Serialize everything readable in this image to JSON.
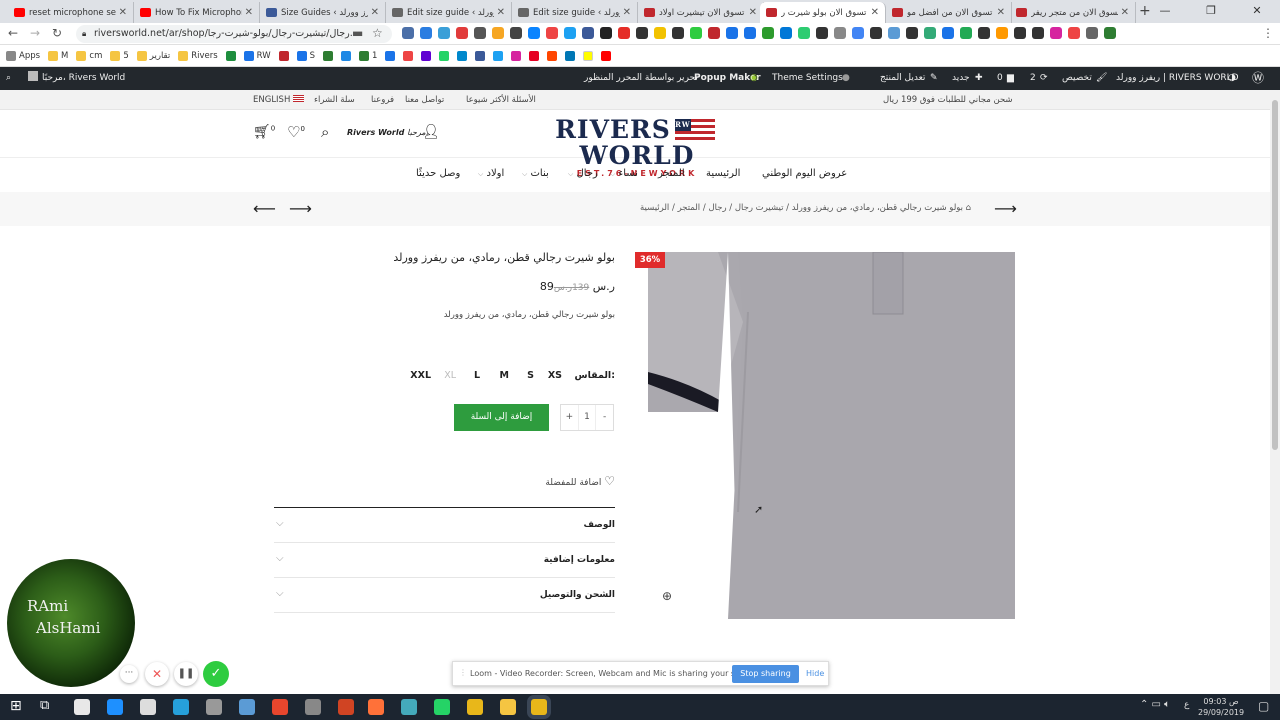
{
  "browser": {
    "tabs": [
      {
        "title": "reset microphone setting",
        "color": "#ff0000"
      },
      {
        "title": "How To Fix Microphone",
        "color": "#ff0000"
      },
      {
        "title": "Size Guides ‹ ريفرز وورلد",
        "color": "#3c5a99"
      },
      {
        "title": "Edit size guide ‹ ريفرز وورلد",
        "color": "#666666"
      },
      {
        "title": "Edit size guide ‹ ريفرز وورلد",
        "color": "#666666"
      },
      {
        "title": "تسوق الان تيشيرت اولاد",
        "color": "#c0272d"
      },
      {
        "title": "تسوق الان بولو شيرت ر",
        "color": "#c0272d"
      },
      {
        "title": "تسوق الان من افضل مو",
        "color": "#c0272d"
      },
      {
        "title": "تسوق الان من متجر ريفر",
        "color": "#c0272d"
      }
    ],
    "url": "riversworld.net/ar/shop/رجال/تيشيرت-رجال/بولو-شيرت-رجا...",
    "bookmarks": [
      "Apps",
      "M",
      "cm",
      "5",
      "تقارير",
      "Rivers",
      "RW",
      "S",
      "1"
    ]
  },
  "wpadmin": {
    "site": "ريفرز وورلد | RIVERS WORLD",
    "customize": "تخصيص",
    "updates": "2",
    "comments": "0",
    "new": "جديد",
    "edit": "تعديل المنتج",
    "theme": "Theme Settings",
    "popup": "Popup Maker",
    "editor": "تحرير بواسطة المحرر المنظور",
    "greeting": "مرحبًا، Rivers World"
  },
  "topstrip": {
    "shipping": "شحن مجاني للطلبات فوق 199 ريال",
    "faq": "الأسئلة الأكثر شيوعا",
    "contact": "تواصل معنا",
    "branches": "فروعنا",
    "policy": "سلة الشراء",
    "lang": "ENGLISH"
  },
  "header": {
    "logo_top": "RIVERS",
    "logo_flag": "RW",
    "logo_top2": "WORLD",
    "logo_sub": "EST.76-NEWYORK",
    "greet": "مرحبا،",
    "user": "Rivers World",
    "cart_count": "0",
    "wish_count": "0"
  },
  "nav": [
    "عروض اليوم الوطني",
    "الرئيسية",
    "المتجر",
    "نساء",
    "رجال",
    "بنات",
    "اولاد",
    "وصل حديثًا"
  ],
  "breadcrumb": {
    "home": "الرئيسية",
    "shop": "المتجر",
    "men": "رجال",
    "tshirts": "تيشيرت رجال",
    "current": "بولو شيرت رجالي قطن، رمادي، من ريفرز وورلد"
  },
  "product": {
    "title": "بولو شيرت رجالي قطن، رمادي، من ريفرز وورلد",
    "old_price": "139ر.س",
    "price": "89ر.س",
    "short_desc": "بولو شيرت رجالي قطن، رمادي، من ريفرز وورلد",
    "size_label": "المقاس:",
    "sizes": [
      "XS",
      "S",
      "M",
      "L",
      "XL",
      "XXL"
    ],
    "qty": "1",
    "qty_plus": "+",
    "qty_minus": "-",
    "add_to_cart": "إضافة إلى السلة",
    "wishlist": "اضافة للمفضلة",
    "badge": "36%",
    "tabs": [
      "الوصف",
      "معلومات إضافية",
      "الشحن والتوصيل"
    ]
  },
  "loom": {
    "text": "Loom - Video Recorder: Screen, Webcam and Mic is sharing your screen.",
    "stop": "Stop sharing",
    "hide": "Hide"
  },
  "overlay": {
    "name1": "RAmi",
    "name2": "AlsHami"
  },
  "taskbar": {
    "time": "09:03 ص",
    "date": "29/09/2019",
    "lang": "ع"
  }
}
